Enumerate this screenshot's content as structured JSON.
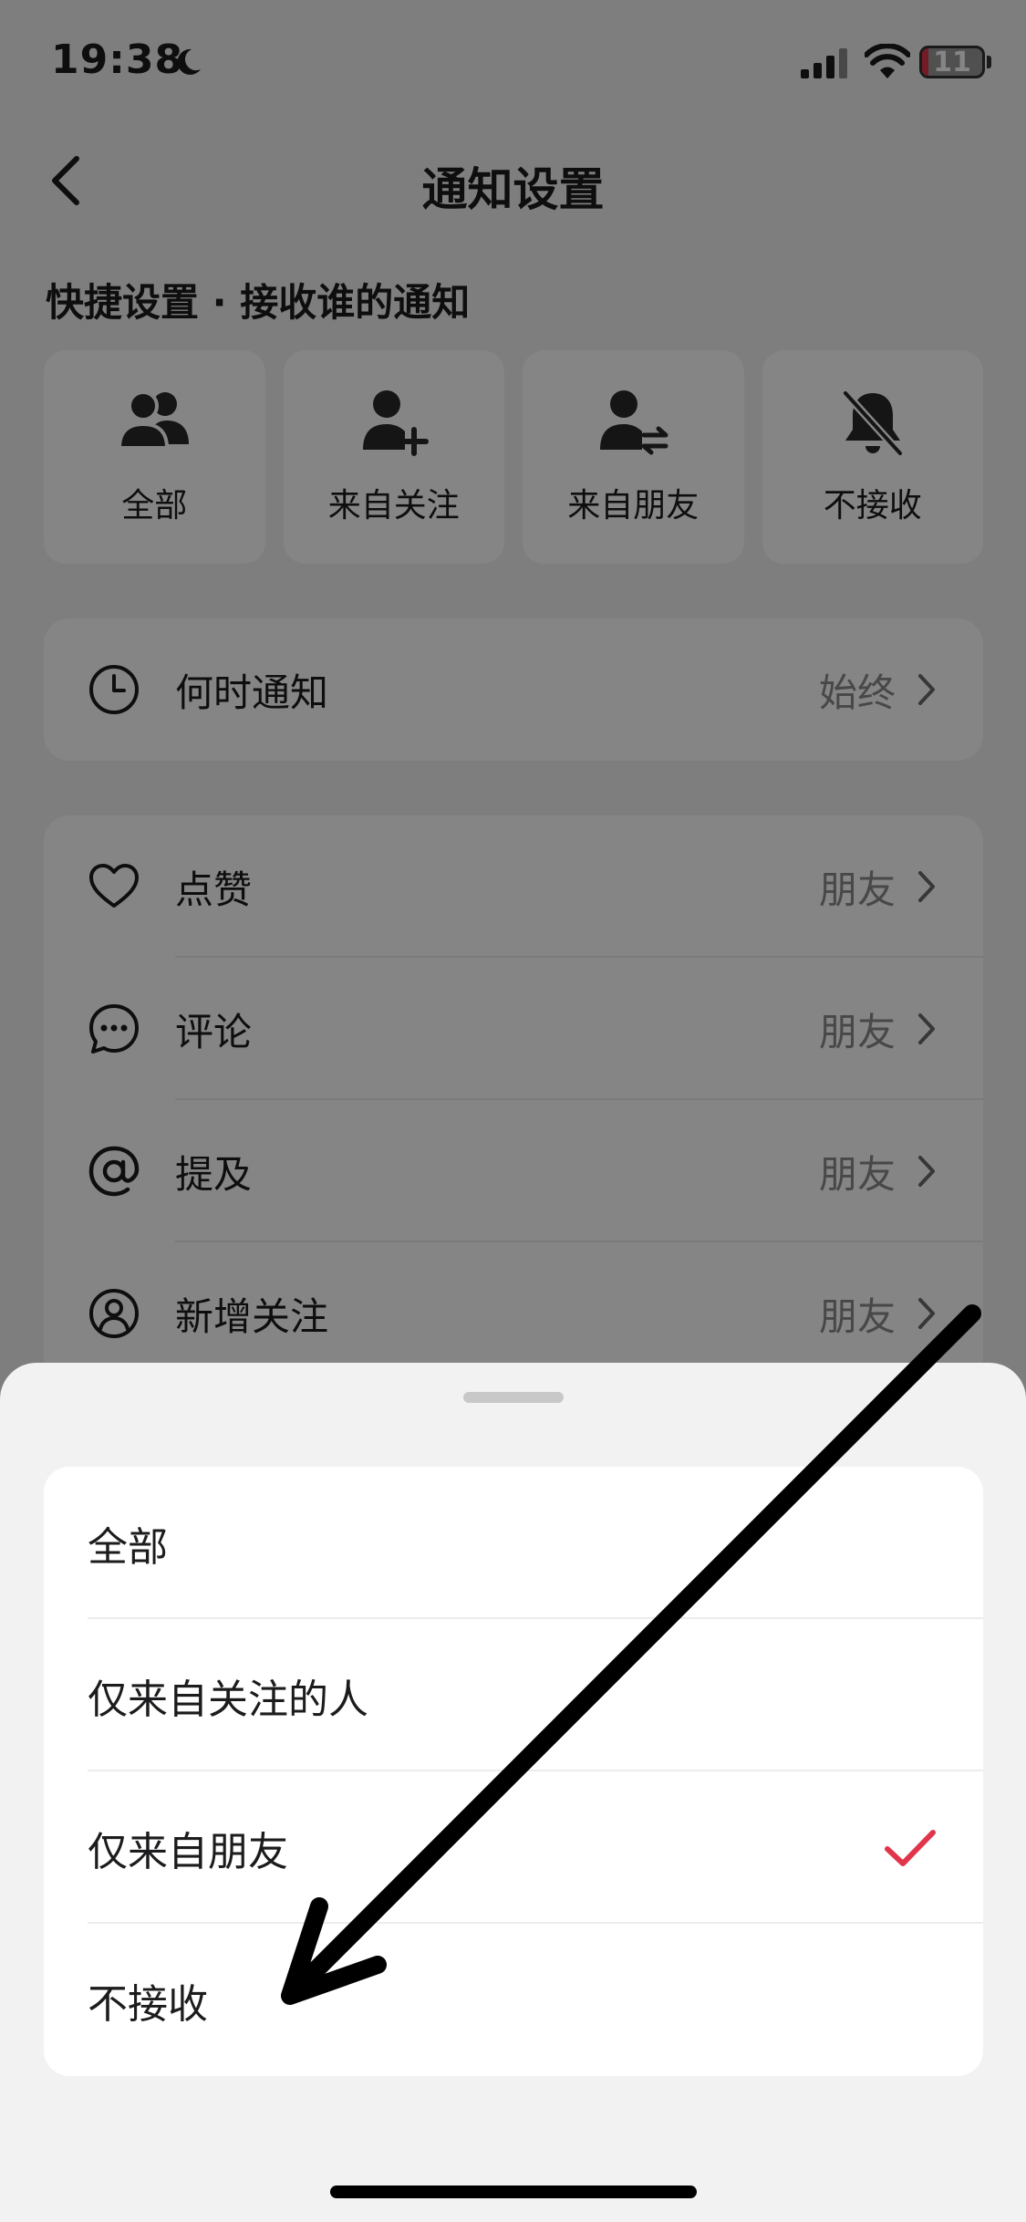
{
  "status_bar": {
    "time": "19:38",
    "battery": "11",
    "battery_level": 0.11
  },
  "header": {
    "title": "通知设置"
  },
  "quick_settings": {
    "title": "快捷设置 · 接收谁的通知",
    "options": [
      {
        "label": "全部",
        "icon": "users-icon"
      },
      {
        "label": "来自关注",
        "icon": "user-add-icon"
      },
      {
        "label": "来自朋友",
        "icon": "user-exchange-icon"
      },
      {
        "label": "不接收",
        "icon": "bell-off-icon"
      }
    ]
  },
  "when": {
    "label": "何时通知",
    "value": "始终"
  },
  "settings": [
    {
      "label": "点赞",
      "value": "朋友",
      "icon": "heart-icon"
    },
    {
      "label": "评论",
      "value": "朋友",
      "icon": "comment-icon"
    },
    {
      "label": "提及",
      "value": "朋友",
      "icon": "at-icon"
    },
    {
      "label": "新增关注",
      "value": "朋友",
      "icon": "user-circle-icon"
    }
  ],
  "sheet": {
    "options": [
      {
        "label": "全部",
        "selected": false
      },
      {
        "label": "仅来自关注的人",
        "selected": false
      },
      {
        "label": "仅来自朋友",
        "selected": true
      },
      {
        "label": "不接收",
        "selected": false
      }
    ]
  },
  "colors": {
    "accent": "#e0354a",
    "background": "#f2f2f2",
    "card": "#ffffff"
  }
}
